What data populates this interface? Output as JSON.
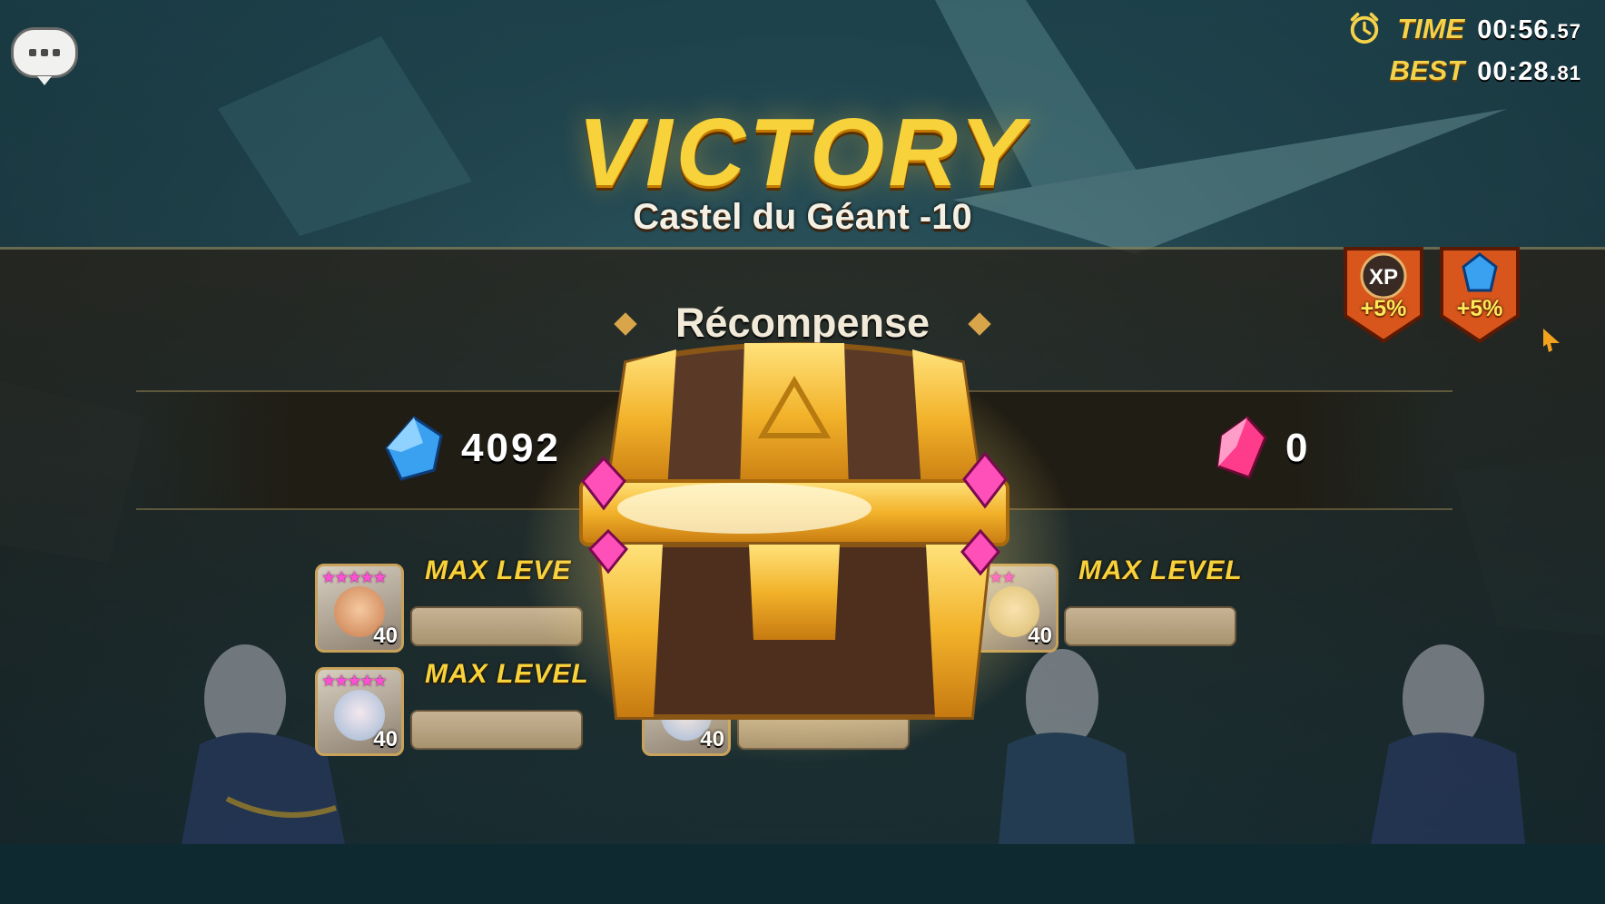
{
  "header": {
    "chat_icon": "chat-bubble-icon",
    "time_label": "TIME",
    "time_main": "00:56.",
    "time_fraction": "57",
    "best_label": "BEST",
    "best_main": "00:28.",
    "best_fraction": "81",
    "clock_icon": "alarm-clock-icon"
  },
  "result": {
    "title": "VICTORY",
    "stage": "Castel du Géant -10"
  },
  "bonuses": [
    {
      "icon": "xp-icon",
      "text": "+5%",
      "icon_label": "XP"
    },
    {
      "icon": "crystal-icon",
      "text": "+5%"
    }
  ],
  "reward": {
    "label": "Récompense",
    "mana": {
      "icon": "mana-crystal-icon",
      "value": "4092"
    },
    "crystal": {
      "icon": "pink-crystal-icon",
      "value": "0"
    },
    "chest_icon": "treasure-chest-icon"
  },
  "units": [
    {
      "stars": "★★★★★",
      "level": "40",
      "status": "MAX LEVEL",
      "shown_status": "MAX LEVE"
    },
    {
      "stars": "★★★★★",
      "level": "40",
      "status": "MAX LEVEL"
    },
    {
      "stars": "★★★",
      "level": "40",
      "status": "MAX LEVEL"
    },
    {
      "stars": "",
      "level": "40",
      "status": ""
    }
  ],
  "colors": {
    "gold": "#f7d23b",
    "mana_blue": "#3aa0f0",
    "crystal_pink": "#ff3c8c",
    "badge_orange": "#d8561c"
  }
}
